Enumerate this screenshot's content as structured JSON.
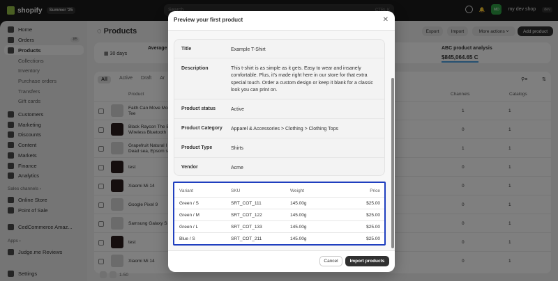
{
  "topbar": {
    "brand": "shopify",
    "edition": "Summer '25",
    "search_placeholder": "Search",
    "search_shortcut": "CTRL K",
    "shop_avatar": "MD",
    "shop_name": "my dev shop",
    "dev_badge": "dev"
  },
  "sidebar": {
    "items": [
      {
        "label": "Home"
      },
      {
        "label": "Orders",
        "count": "85"
      },
      {
        "label": "Products"
      },
      {
        "label": "Collections"
      },
      {
        "label": "Inventory"
      },
      {
        "label": "Purchase orders"
      },
      {
        "label": "Transfers"
      },
      {
        "label": "Gift cards"
      },
      {
        "label": "Customers"
      },
      {
        "label": "Marketing"
      },
      {
        "label": "Discounts"
      },
      {
        "label": "Content"
      },
      {
        "label": "Markets"
      },
      {
        "label": "Finance"
      },
      {
        "label": "Analytics"
      }
    ],
    "sales_channels_label": "Sales channels",
    "channels": [
      {
        "label": "Online Store"
      },
      {
        "label": "Point of Sale"
      }
    ],
    "ced": "CedCommerce Amaz...",
    "apps_label": "Apps",
    "apps": [
      {
        "label": "Judge.me Reviews"
      }
    ],
    "settings": "Settings"
  },
  "main": {
    "title": "Products",
    "export": "Export",
    "import": "Import",
    "more_actions": "More actions",
    "add_product": "Add product",
    "period": "30 days",
    "average": "Average",
    "abc_title": "ABC product analysis",
    "abc_value": "$845,064.65 C",
    "tabs": [
      "All",
      "Active",
      "Draft",
      "Ar"
    ],
    "col_product": "Product",
    "col_channels": "Channels",
    "col_catalogs": "Catalogs",
    "rows": [
      {
        "name": "Faith Can Move Mo Tee",
        "channels": "1",
        "catalogs": "1"
      },
      {
        "name": "Black Raycon The E Wireless Bluetooth",
        "channels": "0",
        "catalogs": "1"
      },
      {
        "name": "Grapefruit Natural I Dead sea, Epsom s",
        "channels": "1",
        "catalogs": "1"
      },
      {
        "name": "test",
        "channels": "0",
        "catalogs": "1"
      },
      {
        "name": "Xiaomi Mi 14",
        "channels": "0",
        "catalogs": "1"
      },
      {
        "name": "Google Pixel 9",
        "channels": "0",
        "catalogs": "1"
      },
      {
        "name": "Samsung Galaxy S",
        "channels": "0",
        "catalogs": "1"
      },
      {
        "name": "test",
        "channels": "0",
        "catalogs": "1"
      },
      {
        "name": "Xiaomi Mi 14",
        "channels": "0",
        "catalogs": "1"
      }
    ],
    "pager": "1-50"
  },
  "modal": {
    "title": "Preview your first product",
    "details": [
      {
        "label": "Title",
        "value": "Example T-Shirt"
      },
      {
        "label": "Description",
        "value": "This t-shirt is as simple as it gets. Easy to wear and insanely comfortable. Plus, it's made right here in our store for that extra special touch. Order a custom design or keep it blank for a classic look you can print on."
      },
      {
        "label": "Product status",
        "value": "Active"
      },
      {
        "label": "Product Category",
        "value": "Apparel & Accessories > Clothing > Clothing Tops"
      },
      {
        "label": "Product Type",
        "value": "Shirts"
      },
      {
        "label": "Vendor",
        "value": "Acme"
      }
    ],
    "variant_headers": {
      "variant": "Variant",
      "sku": "SKU",
      "weight": "Weight",
      "price": "Price"
    },
    "variants": [
      {
        "variant": "Green / S",
        "sku": "SRT_COT_111",
        "weight": "145.00g",
        "price": "$25.00"
      },
      {
        "variant": "Green / M",
        "sku": "SRT_COT_122",
        "weight": "145.00g",
        "price": "$25.00"
      },
      {
        "variant": "Green / L",
        "sku": "SRT_COT_133",
        "weight": "145.00g",
        "price": "$25.00"
      },
      {
        "variant": "Blue / S",
        "sku": "SRT_COT_211",
        "weight": "145.00g",
        "price": "$25.00"
      }
    ],
    "cancel": "Cancel",
    "import": "Import products"
  }
}
